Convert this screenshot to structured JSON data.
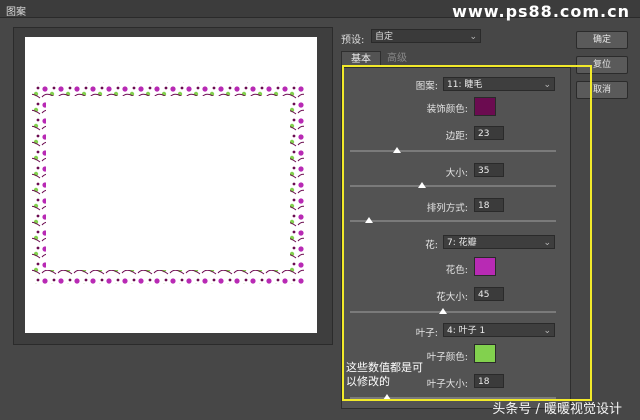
{
  "window": {
    "title": "图案"
  },
  "watermark_top": "www.ps88.com.cn",
  "preset": {
    "label": "预设:",
    "value": "自定"
  },
  "tabs": [
    {
      "label": "基本"
    },
    {
      "label": "高级"
    }
  ],
  "buttons": {
    "ok": "确定",
    "reset": "复位",
    "cancel": "取消"
  },
  "fields": {
    "pattern": {
      "label": "图案:",
      "value": "11: 睫毛"
    },
    "decoration_color": {
      "label": "装饰颜色:",
      "color": "#6b0b50"
    },
    "margin": {
      "label": "边距:",
      "value": "23",
      "fraction": 0.23
    },
    "size": {
      "label": "大小:",
      "value": "35",
      "fraction": 0.35
    },
    "arrangement": {
      "label": "排列方式:",
      "value": "18",
      "fraction": 0.09
    },
    "flower": {
      "label": "花:",
      "value": "7: 花瓣"
    },
    "flower_color": {
      "label": "花色:",
      "color": "#b82ab4"
    },
    "flower_size": {
      "label": "花大小:",
      "value": "45",
      "fraction": 0.45
    },
    "leaf": {
      "label": "叶子:",
      "value": "4: 叶子 1"
    },
    "leaf_color": {
      "label": "叶子颜色:",
      "color": "#82d14e"
    },
    "leaf_size": {
      "label": "叶子大小:",
      "value": "18",
      "fraction": 0.18
    }
  },
  "note": "这些数值都是可以修改的",
  "watermark_bottom": "头条号 / 暖暖视觉设计"
}
